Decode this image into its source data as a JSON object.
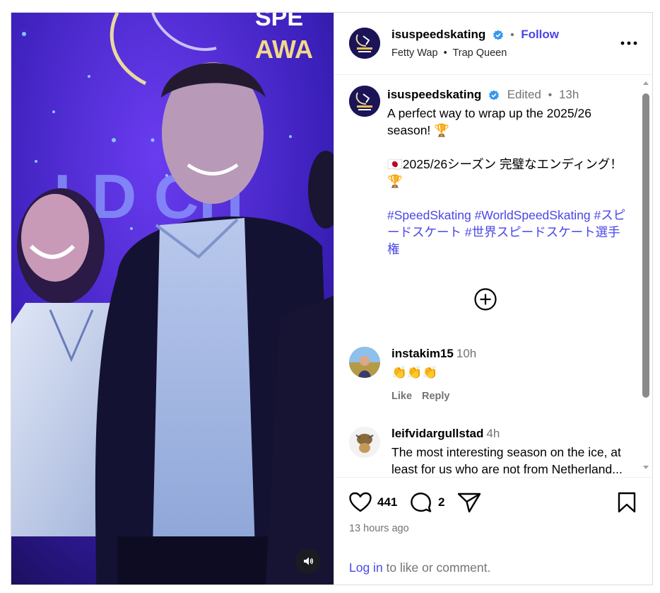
{
  "post": {
    "username": "isuspeedskating",
    "follow_label": "Follow",
    "separator": "•",
    "audio_artist": "Fetty Wap",
    "audio_title": "Trap Queen",
    "media_overlay_text_1": "SPE",
    "media_overlay_text_2": "AWA",
    "media_overlay_text_3": "LD CH"
  },
  "caption": {
    "username": "isuspeedskating",
    "edited_label": "Edited",
    "separator": "•",
    "time": "13h",
    "line1": "A perfect way to wrap up the 2025/26 season! 🏆",
    "line2": "🇯🇵2025/26シーズン 完璧なエンディング！🏆",
    "hashtags": "#SpeedSkating #WorldSpeedSkating #スピードスケート #世界スピードスケート選手権"
  },
  "comments": [
    {
      "username": "instakim15",
      "time": "10h",
      "text": "👏👏👏",
      "like_label": "Like",
      "reply_label": "Reply"
    },
    {
      "username": "leifvidargullstad",
      "time": "4h",
      "text": "The most interesting season on the ice, at least for us who are not from Netherland... 🥰 But of course i dont"
    }
  ],
  "actions": {
    "likes": "441",
    "comments": "2",
    "time_ago": "13 hours ago",
    "login_link": "Log in",
    "login_suffix": " to like or comment."
  },
  "icons": {
    "verified": "verified-badge-icon",
    "more": "more-options-icon",
    "expand": "plus-circle-icon",
    "like": "heart-icon",
    "comment": "comment-bubble-icon",
    "share": "paper-plane-icon",
    "save": "bookmark-icon",
    "audio": "speaker-icon"
  },
  "colors": {
    "link": "#4a46e8",
    "verified": "#3897f0",
    "secondary": "#737373"
  }
}
